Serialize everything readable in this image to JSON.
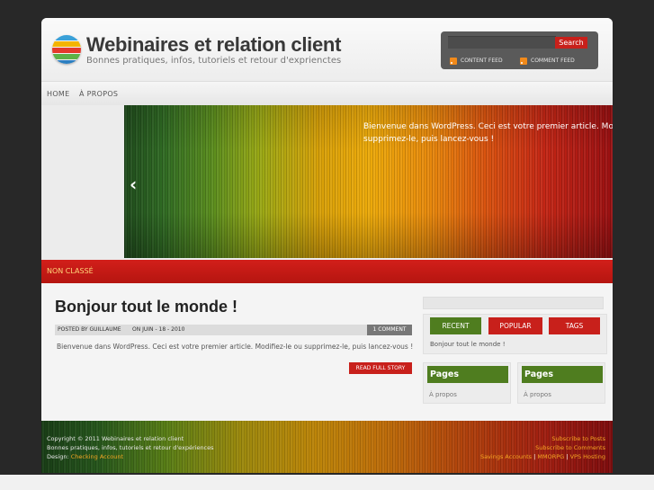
{
  "header": {
    "title": "Webinaires et relation client",
    "tagline": "Bonnes pratiques, infos, tutoriels et retour d'exprienctes",
    "search_button": "Search",
    "search_placeholder": "",
    "content_feed": "CONTENT FEED",
    "comment_feed": "COMMENT FEED"
  },
  "nav": {
    "items": [
      "HOME",
      "À PROPOS"
    ]
  },
  "slider": {
    "caption": "Bienvenue dans WordPress. Ceci est votre premier article. Modifiez-le ou supprimez-le, puis lancez-vous !",
    "prev_arrow": "‹"
  },
  "category": {
    "label": "NON CLASSÉ"
  },
  "post": {
    "title": "Bonjour tout le monde !",
    "author": "POSTED BY GUILLAUME",
    "date": "ON JUIN - 18 - 2010",
    "comments": "1 COMMENT",
    "excerpt": "Bienvenue dans WordPress. Ceci est votre premier article. Modifiez-le ou supprimez-le, puis lancez-vous !",
    "read_more": "READ FULL STORY"
  },
  "sidebar": {
    "tabs": [
      "RECENT",
      "POPULAR",
      "TAGS"
    ],
    "recent_item": "Bonjour tout le monde !",
    "widgets": [
      {
        "title": "Pages",
        "link": "À propos"
      },
      {
        "title": "Pages",
        "link": "À propos"
      }
    ]
  },
  "footer": {
    "copyright": "Copyright © 2011 Webinaires et relation client",
    "tagline": "Bonnes pratiques, infos, tutoriels et retour d'expériences",
    "design_label": "Design:",
    "design_link": "Checking Account",
    "subscribe_posts": "Subscribe to Posts",
    "subscribe_comments": "Subscribe to Comments",
    "links": [
      "Savings Accounts",
      "MMORPG",
      "VPS Hosting"
    ],
    "separator": "|"
  },
  "colors": {
    "accent_red": "#c8201b",
    "accent_green": "#4f7d1f",
    "footer_link": "#f5a623"
  }
}
